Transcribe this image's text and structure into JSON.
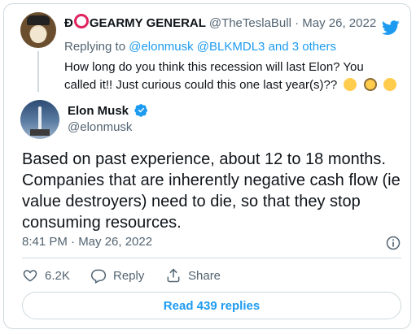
{
  "reply_tweet": {
    "display_name_prefix": "Đ",
    "display_name_suffix": "GEARMY GENERAL",
    "handle": "@TheTeslaBull",
    "separator": "·",
    "date": "May 26, 2022",
    "replying_prefix": "Replying to",
    "replying_mentions": "@elonmusk @BLKMDL3",
    "replying_suffix": "and 3 others",
    "text": "How long do you think this recession will last Elon? You called it!! Just curious could this one last year(s)??"
  },
  "main_tweet": {
    "display_name": "Elon Musk",
    "handle": "@elonmusk",
    "text": "Based on past experience, about 12 to 18 months. Companies that are inherently negative cash flow (ie value destroyers) need to die, so that they stop consuming resources.",
    "timestamp": "8:41 PM · May 26, 2022"
  },
  "actions": {
    "like_count": "6.2K",
    "reply_label": "Reply",
    "share_label": "Share"
  },
  "read_replies_label": "Read 439 replies",
  "colors": {
    "accent": "#1d9bf0",
    "secondary_text": "#536471",
    "border": "#cfd9de",
    "ring": "#e0245e"
  },
  "icons": [
    "twitter-bird-icon",
    "verified-badge-icon",
    "info-icon",
    "heart-icon",
    "reply-bubble-icon",
    "share-icon",
    "thinking-emoji-icon",
    "monocle-emoji-icon",
    "raised-eyebrow-emoji-icon"
  ]
}
